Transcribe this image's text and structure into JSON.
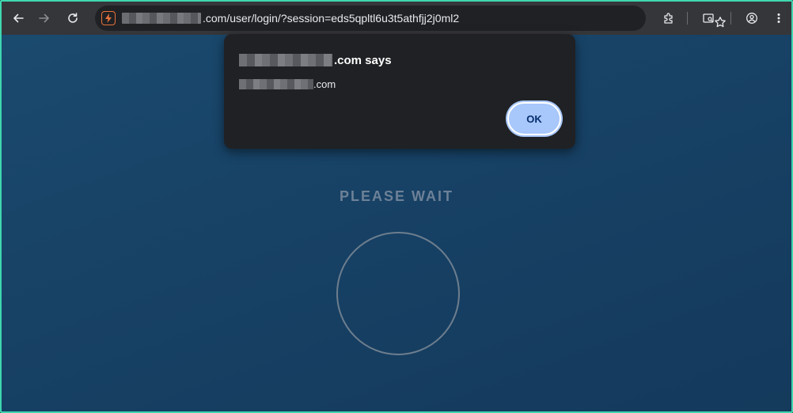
{
  "browser": {
    "url_visible": ".com/user/login/?session=eds5qpltl6u3t5athfjj2j0ml2",
    "icons": {
      "back": "arrow-left-icon",
      "forward": "arrow-right-icon",
      "reload": "reload-icon",
      "site": "site-info-icon",
      "bookmark": "star-icon",
      "extensions": "puzzle-icon",
      "reading": "reading-mode-icon",
      "profile": "profile-icon",
      "menu": "kebab-menu-icon"
    }
  },
  "dialog": {
    "title_suffix": ".com says",
    "message_suffix": ".com",
    "ok_label": "OK"
  },
  "page": {
    "status_text": "PLEASE WAIT"
  },
  "colors": {
    "frame_border": "#3fd6b0",
    "toolbar_bg": "#35363a",
    "dialog_bg": "#202124",
    "ok_button": "#a8c7fa",
    "page_bg": "#174165",
    "site_icon": "#e8743b"
  }
}
